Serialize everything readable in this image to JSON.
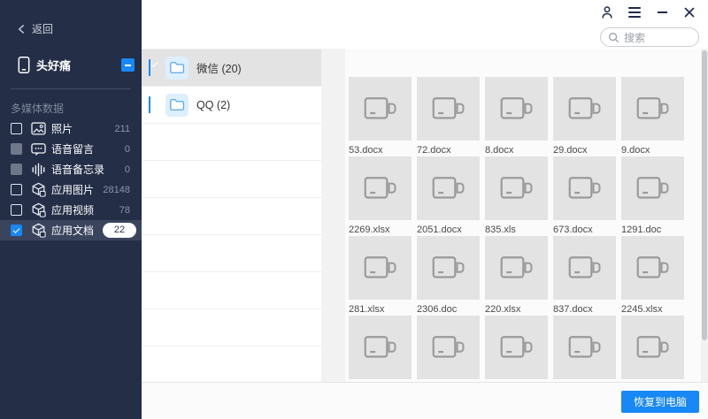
{
  "sidebar": {
    "back_label": "返回",
    "device": {
      "name": "头好痛",
      "checkbox_state": "indeterminate"
    },
    "section_label": "多媒体数据",
    "items": [
      {
        "label": "照片",
        "count": "211",
        "icon": "photo-icon",
        "state": "unchecked",
        "selected": false,
        "badge": false
      },
      {
        "label": "语音留言",
        "count": "0",
        "icon": "voice-message-icon",
        "state": "disabled",
        "selected": false,
        "badge": false
      },
      {
        "label": "语音备忘录",
        "count": "0",
        "icon": "voice-memo-icon",
        "state": "disabled",
        "selected": false,
        "badge": false
      },
      {
        "label": "应用图片",
        "count": "28148",
        "icon": "app-cube-icon",
        "state": "unchecked",
        "selected": false,
        "badge": false
      },
      {
        "label": "应用视频",
        "count": "78",
        "icon": "app-cube-icon",
        "state": "unchecked",
        "selected": false,
        "badge": false
      },
      {
        "label": "应用文档",
        "count": "22",
        "icon": "app-cube-icon",
        "state": "checked",
        "selected": true,
        "badge": true
      }
    ]
  },
  "titlebar": {
    "icons": [
      "user-icon",
      "menu-icon",
      "minimize-icon",
      "close-icon"
    ]
  },
  "search": {
    "placeholder": "搜索"
  },
  "folder_list": {
    "folders": [
      {
        "label": "微信 (20)",
        "checked": true,
        "selected": true
      },
      {
        "label": "QQ (2)",
        "checked": true,
        "selected": false
      }
    ],
    "empty_row_count": 7
  },
  "files": {
    "placeholder_icon": "video-camera-icon",
    "items": [
      {
        "name": "53.docx"
      },
      {
        "name": "72.docx"
      },
      {
        "name": "8.docx"
      },
      {
        "name": "29.docx"
      },
      {
        "name": "9.docx"
      },
      {
        "name": "2269.xlsx"
      },
      {
        "name": "2051.docx"
      },
      {
        "name": "835.xls"
      },
      {
        "name": "673.docx"
      },
      {
        "name": "1291.doc"
      },
      {
        "name": "281.xlsx"
      },
      {
        "name": "2306.doc"
      },
      {
        "name": "220.xlsx"
      },
      {
        "name": "837.docx"
      },
      {
        "name": "2245.xlsx"
      },
      {
        "name": ""
      },
      {
        "name": ""
      },
      {
        "name": ""
      },
      {
        "name": ""
      },
      {
        "name": ""
      }
    ]
  },
  "footer": {
    "recover_button_label": "恢复到电脑"
  },
  "colors": {
    "accent_blue": "#1788f5",
    "sidebar_bg": "#242e47",
    "sidebar_selected": "#3a445d",
    "tile_bg": "#e3e3e3",
    "folder_selected": "#e3e3e3"
  }
}
